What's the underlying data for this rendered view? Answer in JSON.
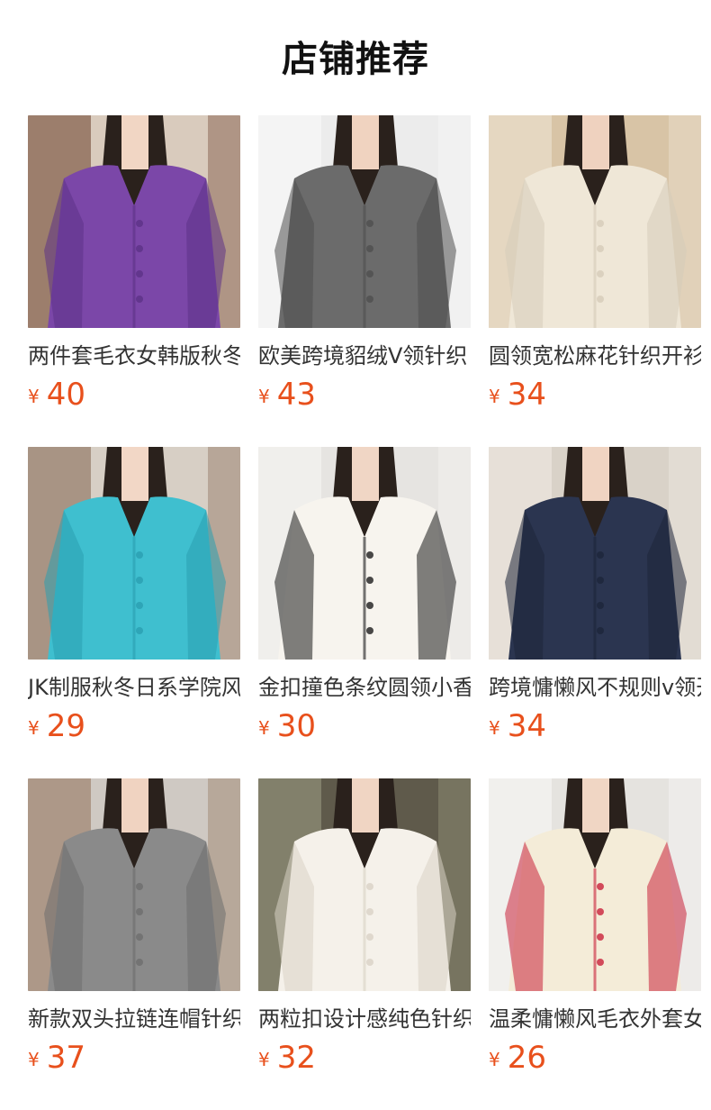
{
  "section": {
    "title": "店铺推荐"
  },
  "currency": "¥",
  "products": [
    {
      "name": "两件套毛衣女韩版秋冬",
      "price": "40",
      "image": "purple-cardigan-photo",
      "colors": {
        "bg": "#d9cbbd",
        "wall": "#8c6a57",
        "garment": "#7b47a8",
        "garment_dark": "#5d3286",
        "skin": "#f1d6c4"
      }
    },
    {
      "name": "欧美跨境貂绒V领针织",
      "price": "43",
      "image": "grey-fuzzy-cardigan-photo",
      "colors": {
        "bg": "#ececec",
        "wall": "#f6f6f6",
        "garment": "#6b6b6b",
        "garment_dark": "#4f4f4f",
        "skin": "#f0d3c0"
      }
    },
    {
      "name": "圆领宽松麻花针织开衫",
      "price": "34",
      "image": "cream-cable-knit-photo",
      "colors": {
        "bg": "#d8c4a6",
        "wall": "#e9dcc8",
        "garment": "#efe7d7",
        "garment_dark": "#d6ccb9",
        "skin": "#efd2bf"
      }
    },
    {
      "name": "JK制服秋冬日系学院风",
      "price": "29",
      "image": "blue-sailor-cardigan-photo",
      "colors": {
        "bg": "#d7cfc5",
        "wall": "#9c8573",
        "garment": "#3fbfcf",
        "garment_dark": "#2a9fb0",
        "skin": "#f2d7c6"
      }
    },
    {
      "name": "金扣撞色条纹圆领小香风",
      "price": "30",
      "image": "striped-cardigan-photo",
      "colors": {
        "bg": "#e6e4e1",
        "wall": "#f2f1ef",
        "garment": "#f7f4ee",
        "garment_dark": "#1b1b1b",
        "skin": "#f0d6c5"
      }
    },
    {
      "name": "跨境慵懒风不规则v领开衫",
      "price": "34",
      "image": "navy-asymmetric-cardigan-photo",
      "colors": {
        "bg": "#d9d2c8",
        "wall": "#eae4dc",
        "garment": "#2b3550",
        "garment_dark": "#1d2539",
        "skin": "#f0d4c2"
      }
    },
    {
      "name": "新款双头拉链连帽针织衫",
      "price": "37",
      "image": "grey-zip-hoodie-photo",
      "colors": {
        "bg": "#cfc9c3",
        "wall": "#a48c79",
        "garment": "#8a8a8a",
        "garment_dark": "#6d6d6d",
        "skin": "#f0d3c1"
      }
    },
    {
      "name": "两粒扣设计感纯色针织衫",
      "price": "32",
      "image": "white-two-button-cardigan-photo",
      "colors": {
        "bg": "#5f5a4b",
        "wall": "#8b8a73",
        "garment": "#f5f1ea",
        "garment_dark": "#d9d2c5",
        "skin": "#f0d5c3"
      }
    },
    {
      "name": "温柔慵懒风毛衣外套女",
      "price": "26",
      "image": "cream-heart-cardigan-photo",
      "colors": {
        "bg": "#e5e3df",
        "wall": "#f4f3f0",
        "garment": "#f4ecd8",
        "garment_dark": "#c9223b",
        "skin": "#f0d6c4"
      }
    }
  ]
}
